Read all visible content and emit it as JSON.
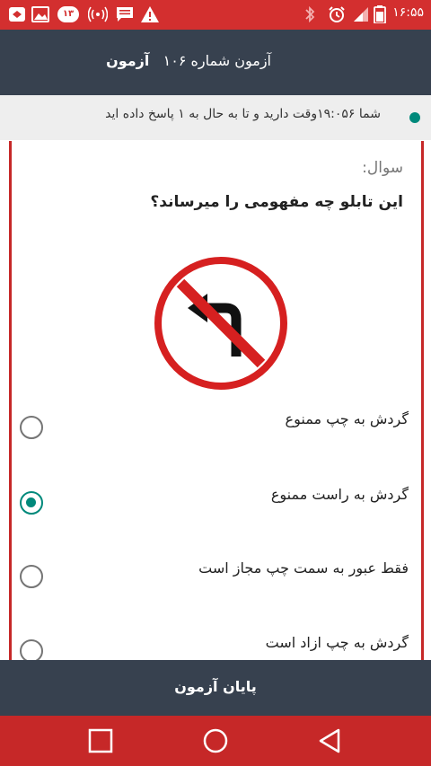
{
  "status_bar": {
    "time": "۱۶:۵۵",
    "notification_count": "۱۳",
    "icons": [
      "remote-access-icon",
      "gallery-icon",
      "notification-count-badge",
      "wifi-hotspot-icon",
      "message-icon",
      "warning-icon",
      "bluetooth-icon",
      "alarm-icon",
      "signal-icon",
      "battery-icon"
    ]
  },
  "app_bar": {
    "title_prefix": "آزمون شماره ۱۰۶",
    "title_bold": "آزمون"
  },
  "info": {
    "text": "شما ۱۹:۰۵۶وقت دارید و تا به حال به ۱ پاسخ داده اید",
    "dot_color": "#00897b"
  },
  "question": {
    "label": "سوال:",
    "text": "این تابلو چه مفهومی را میرساند؟",
    "image": "no-left-turn-sign"
  },
  "options": [
    {
      "label": "گردش به چپ ممنوع",
      "selected": false
    },
    {
      "label": "گردش به راست ممنوع",
      "selected": true
    },
    {
      "label": "فقط عبور به سمت چپ مجاز است",
      "selected": false
    },
    {
      "label": "گردش به چپ ازاد است",
      "selected": false
    }
  ],
  "footer": {
    "finish_label": "پایان آزمون"
  },
  "nav_bar": {
    "buttons": [
      "recents-square-icon",
      "home-circle-icon",
      "back-triangle-icon"
    ]
  },
  "colors": {
    "status_bar": "#d32f2f",
    "app_bar": "#37414f",
    "accent": "#00897b",
    "card_border": "#c62828"
  }
}
